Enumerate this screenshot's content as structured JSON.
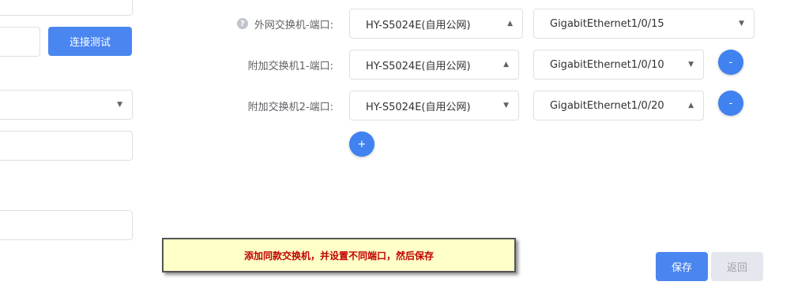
{
  "left_panel": {
    "connection_test_label": "连接测试"
  },
  "switches": {
    "external": {
      "label": "外网交换机-端口:",
      "device": "HY-S5024E(自用公网)",
      "port": "GigabitEthernet1/0/15"
    },
    "extra": [
      {
        "label": "附加交换机1-端口:",
        "device": "HY-S5024E(自用公网)",
        "port": "GigabitEthernet1/0/10",
        "remove_label": "-"
      },
      {
        "label": "附加交换机2-端口:",
        "device": "HY-S5024E(自用公网)",
        "port": "GigabitEthernet1/0/20",
        "remove_label": "-"
      }
    ],
    "add_label": "+"
  },
  "hint": {
    "text": "添加同款交换机，并设置不同端口，然后保存"
  },
  "footer": {
    "save_label": "保存",
    "back_label": "返回"
  },
  "icons": {
    "help": "question-circle-icon",
    "caret_up": "caret-up-icon",
    "caret_down": "caret-down-icon"
  },
  "colors": {
    "primary": "#4a86f0",
    "hint_text": "#c00000",
    "hint_background": "#ffffc8"
  }
}
